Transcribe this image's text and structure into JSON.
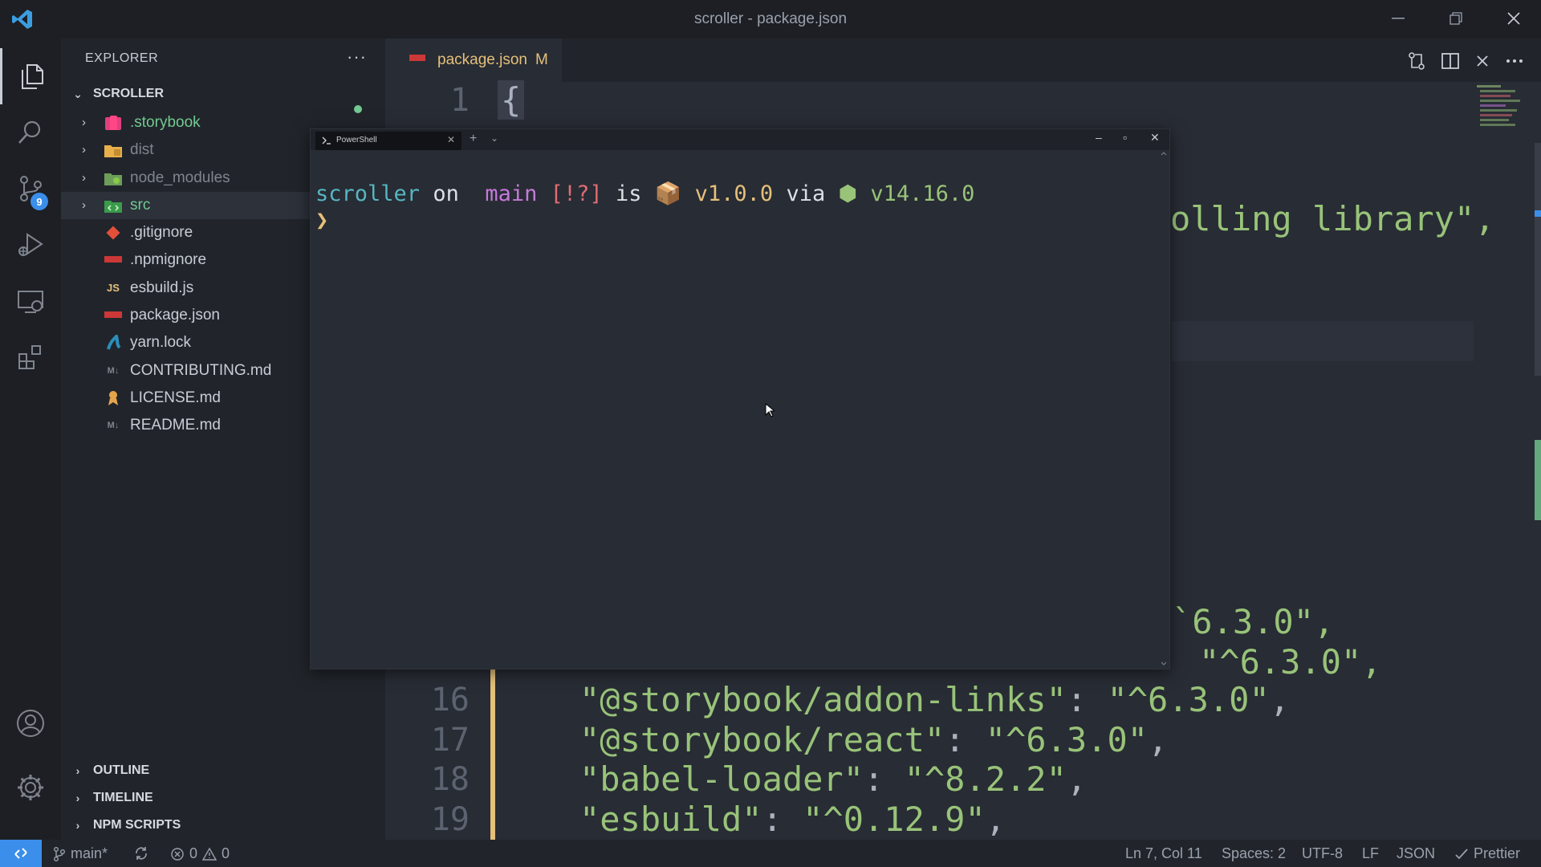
{
  "window": {
    "title": "scroller - package.json"
  },
  "activity_bar": {
    "source_control_badge": "9"
  },
  "sidebar": {
    "header": "EXPLORER",
    "more": "···",
    "root": "SCROLLER",
    "items": [
      {
        "name": ".storybook",
        "type": "folder",
        "color": "#73c991"
      },
      {
        "name": "dist",
        "type": "folder",
        "color": "#7f848e"
      },
      {
        "name": "node_modules",
        "type": "folder",
        "color": "#7f848e"
      },
      {
        "name": "src",
        "type": "folder",
        "color": "#73c991"
      },
      {
        "name": ".gitignore",
        "type": "file",
        "color": "#c8ccd4"
      },
      {
        "name": ".npmignore",
        "type": "file",
        "color": "#c8ccd4"
      },
      {
        "name": "esbuild.js",
        "type": "file",
        "color": "#c8ccd4",
        "icon_text": "JS"
      },
      {
        "name": "package.json",
        "type": "file",
        "color": "#c8ccd4"
      },
      {
        "name": "yarn.lock",
        "type": "file",
        "color": "#c8ccd4"
      },
      {
        "name": "CONTRIBUTING.md",
        "type": "file",
        "color": "#c8ccd4",
        "icon_text": "M↓"
      },
      {
        "name": "LICENSE.md",
        "type": "file",
        "color": "#c8ccd4"
      },
      {
        "name": "README.md",
        "type": "file",
        "color": "#c8ccd4",
        "icon_text": "M↓"
      }
    ],
    "sections": [
      "OUTLINE",
      "TIMELINE",
      "NPM SCRIPTS"
    ]
  },
  "editor": {
    "tab": {
      "name": "package.json",
      "modified": "M"
    },
    "lines": [
      {
        "num": "1",
        "text": "{"
      },
      {
        "num": "16",
        "key": "\"@storybook/addon-links\"",
        "value": "\"^6.3.0\""
      },
      {
        "num": "17",
        "key": "\"@storybook/react\"",
        "value": "\"^6.3.0\""
      },
      {
        "num": "18",
        "key": "\"babel-loader\"",
        "value": "\"^8.2.2\""
      },
      {
        "num": "19",
        "key": "\"esbuild\"",
        "value": "\"^0.12.9\""
      }
    ],
    "fragments": {
      "description_tail": "olling library\",",
      "version_a": "`6.3.0\",",
      "version_b": "\"^6.3.0\","
    }
  },
  "terminal": {
    "tab_label": "PowerShell",
    "prompt": {
      "dir": "scroller",
      "on": "on",
      "branch_icon": "",
      "branch": "main",
      "status": "[!?]",
      "is": "is",
      "package_icon": "📦",
      "version": "v1.0.0",
      "via": "via",
      "node_icon": "⬢",
      "node_version": "v14.16.0",
      "caret": "❯"
    }
  },
  "statusbar": {
    "branch": "main*",
    "errors": "0",
    "warnings": "0",
    "position": "Ln 7, Col 11",
    "spaces": "Spaces: 2",
    "encoding": "UTF-8",
    "eol": "LF",
    "language": "JSON",
    "formatter": "Prettier"
  }
}
